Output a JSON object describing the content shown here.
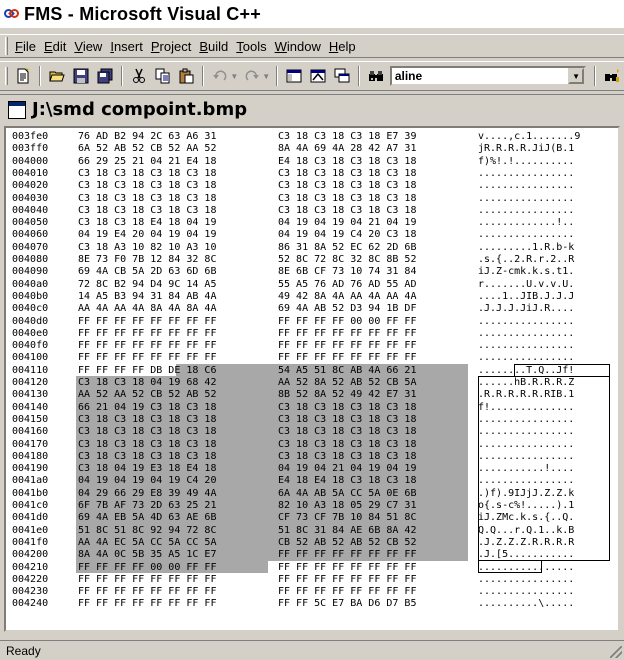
{
  "window": {
    "title": "FMS - Microsoft Visual C++"
  },
  "menu": [
    {
      "label": "File",
      "u": "F",
      "rest": "ile"
    },
    {
      "label": "Edit",
      "u": "E",
      "rest": "dit"
    },
    {
      "label": "View",
      "u": "V",
      "rest": "iew"
    },
    {
      "label": "Insert",
      "u": "I",
      "rest": "nsert"
    },
    {
      "label": "Project",
      "u": "P",
      "rest": "roject"
    },
    {
      "label": "Build",
      "u": "B",
      "rest": "uild"
    },
    {
      "label": "Tools",
      "u": "T",
      "rest": "ools"
    },
    {
      "label": "Window",
      "u": "W",
      "rest": "indow"
    },
    {
      "label": "Help",
      "u": "H",
      "rest": "elp"
    }
  ],
  "toolbar": {
    "find_value": "aline"
  },
  "document": {
    "title": "J:\\smd compoint.bmp"
  },
  "hex_rows": [
    {
      "addr": "003fe0",
      "h1": "76 AD B2 94 2C 63 A6 31",
      "h2": "C3 18 C3 18 C3 18 E7 39",
      "asc": "v....,c.1.......9"
    },
    {
      "addr": "003ff0",
      "h1": "6A 52 AB 52 CB 52 AA 52",
      "h2": "8A 4A 69 4A 28 42 A7 31",
      "asc": "jR.R.R.R.JiJ(B.1"
    },
    {
      "addr": "004000",
      "h1": "66 29 25 21 04 21 E4 18",
      "h2": "E4 18 C3 18 C3 18 C3 18",
      "asc": "f)%!.!.........."
    },
    {
      "addr": "004010",
      "h1": "C3 18 C3 18 C3 18 C3 18",
      "h2": "C3 18 C3 18 C3 18 C3 18",
      "asc": "................"
    },
    {
      "addr": "004020",
      "h1": "C3 18 C3 18 C3 18 C3 18",
      "h2": "C3 18 C3 18 C3 18 C3 18",
      "asc": "................"
    },
    {
      "addr": "004030",
      "h1": "C3 18 C3 18 C3 18 C3 18",
      "h2": "C3 18 C3 18 C3 18 C3 18",
      "asc": "................"
    },
    {
      "addr": "004040",
      "h1": "C3 18 C3 18 C3 18 C3 18",
      "h2": "C3 18 C3 18 C3 18 C3 18",
      "asc": "................"
    },
    {
      "addr": "004050",
      "h1": "C3 18 C3 18 E4 18 04 19",
      "h2": "04 19 04 19 04 21 04 19",
      "asc": ".............!.."
    },
    {
      "addr": "004060",
      "h1": "04 19 E4 20 04 19 04 19",
      "h2": "04 19 04 19 C4 20 C3 18",
      "asc": "................"
    },
    {
      "addr": "004070",
      "h1": "C3 18 A3 10 82 10 A3 10",
      "h2": "86 31 8A 52 EC 62 2D 6B",
      "asc": ".........1.R.b-k"
    },
    {
      "addr": "004080",
      "h1": "8E 73 F0 7B 12 84 32 8C",
      "h2": "52 8C 72 8C 32 8C 8B 52",
      "asc": ".s.{..2.R.r.2..R"
    },
    {
      "addr": "004090",
      "h1": "69 4A CB 5A 2D 63 6D 6B",
      "h2": "8E 6B CF 73 10 74 31 84",
      "asc": "iJ.Z-cmk.k.s.t1."
    },
    {
      "addr": "0040a0",
      "h1": "72 8C B2 94 D4 9C 14 A5",
      "h2": "55 A5 76 AD 76 AD 55 AD",
      "asc": "r.......U.v.v.U."
    },
    {
      "addr": "0040b0",
      "h1": "14 A5 B3 94 31 84 AB 4A",
      "h2": "49 42 8A 4A AA 4A AA 4A",
      "asc": "....1..JIB.J.J.J"
    },
    {
      "addr": "0040c0",
      "h1": "AA 4A AA 4A 8A 4A 8A 4A",
      "h2": "69 4A AB 52 D3 94 1B DF",
      "asc": ".J.J.J.JiJ.R...."
    },
    {
      "addr": "0040d0",
      "h1": "FF FF FF FF FF FF FF FF",
      "h2": "FF FF FF FF 00 00 FF FF",
      "asc": "................"
    },
    {
      "addr": "0040e0",
      "h1": "FF FF FF FF FF FF FF FF",
      "h2": "FF FF FF FF FF FF FF FF",
      "asc": "................"
    },
    {
      "addr": "0040f0",
      "h1": "FF FF FF FF FF FF FF FF",
      "h2": "FF FF FF FF FF FF FF FF",
      "asc": "................"
    },
    {
      "addr": "004100",
      "h1": "FF FF FF FF FF FF FF FF",
      "h2": "FF FF FF FF FF FF FF FF",
      "asc": "................"
    },
    {
      "addr": "004110",
      "h1": "FF FF FF FF DB DE 18 C6",
      "h2": "54 A5 51 8C AB 4A 66 21",
      "asc": "........T.Q..Jf!"
    },
    {
      "addr": "004120",
      "h1": "C3 18 C3 18 04 19 68 42",
      "h2": "AA 52 8A 52 AB 52 CB 5A",
      "asc": "......hB.R.R.R.Z"
    },
    {
      "addr": "004130",
      "h1": "AA 52 AA 52 CB 52 AB 52",
      "h2": "8B 52 8A 52 49 42 E7 31",
      "asc": ".R.R.R.R.R.RIB.1"
    },
    {
      "addr": "004140",
      "h1": "66 21 04 19 C3 18 C3 18",
      "h2": "C3 18 C3 18 C3 18 C3 18",
      "asc": "f!.............."
    },
    {
      "addr": "004150",
      "h1": "C3 18 C3 18 C3 18 C3 18",
      "h2": "C3 18 C3 18 C3 18 C3 18",
      "asc": "................"
    },
    {
      "addr": "004160",
      "h1": "C3 18 C3 18 C3 18 C3 18",
      "h2": "C3 18 C3 18 C3 18 C3 18",
      "asc": "................"
    },
    {
      "addr": "004170",
      "h1": "C3 18 C3 18 C3 18 C3 18",
      "h2": "C3 18 C3 18 C3 18 C3 18",
      "asc": "................"
    },
    {
      "addr": "004180",
      "h1": "C3 18 C3 18 C3 18 C3 18",
      "h2": "C3 18 C3 18 C3 18 C3 18",
      "asc": "................"
    },
    {
      "addr": "004190",
      "h1": "C3 18 04 19 E3 18 E4 18",
      "h2": "04 19 04 21 04 19 04 19",
      "asc": "...........!...."
    },
    {
      "addr": "0041a0",
      "h1": "04 19 04 19 04 19 C4 20",
      "h2": "E4 18 E4 18 C3 18 C3 18",
      "asc": "................"
    },
    {
      "addr": "0041b0",
      "h1": "04 29 66 29 E8 39 49 4A",
      "h2": "6A 4A AB 5A CC 5A 0E 6B",
      "asc": ".)f).9IJjJ.Z.Z.k"
    },
    {
      "addr": "0041c0",
      "h1": "6F 7B AF 73 2D 63 25 21",
      "h2": "82 10 A3 18 05 29 C7 31",
      "asc": "o{.s-c%!.....).1"
    },
    {
      "addr": "0041d0",
      "h1": "69 4A EB 5A 4D 63 AE 6B",
      "h2": "CF 73 CF 7B 10 84 51 8C",
      "asc": "iJ.ZMc.k.s.{..Q."
    },
    {
      "addr": "0041e0",
      "h1": "51 8C 51 8C 92 94 72 8C",
      "h2": "51 8C 31 84 AE 6B 8A 42",
      "asc": "Q.Q...r.Q.1..k.B"
    },
    {
      "addr": "0041f0",
      "h1": "AA 4A EC 5A CC 5A CC 5A",
      "h2": "CB 52 AB 52 AB 52 CB 52",
      "asc": ".J.Z.Z.Z.R.R.R.R"
    },
    {
      "addr": "004200",
      "h1": "8A 4A 0C 5B 35 A5 1C E7",
      "h2": "FF FF FF FF FF FF FF FF",
      "asc": ".J.[5..........."
    },
    {
      "addr": "004210",
      "h1": "FF FF FF FF 00 00 FF FF",
      "h2": "FF FF FF FF FF FF FF FF",
      "asc": "................"
    },
    {
      "addr": "004220",
      "h1": "FF FF FF FF FF FF FF FF",
      "h2": "FF FF FF FF FF FF FF FF",
      "asc": "................"
    },
    {
      "addr": "004230",
      "h1": "FF FF FF FF FF FF FF FF",
      "h2": "FF FF FF FF FF FF FF FF",
      "asc": "................"
    },
    {
      "addr": "004240",
      "h1": "FF FF FF FF FF FF FF FF",
      "h2": "FF FF 5C E7 BA D6 D7 B5",
      "asc": "..........\\....."
    }
  ],
  "status": {
    "text": "Ready"
  },
  "colors": {
    "selection": "#a8a8a8",
    "chrome": "#d4d0c8",
    "title_bg": "#ffffff"
  }
}
